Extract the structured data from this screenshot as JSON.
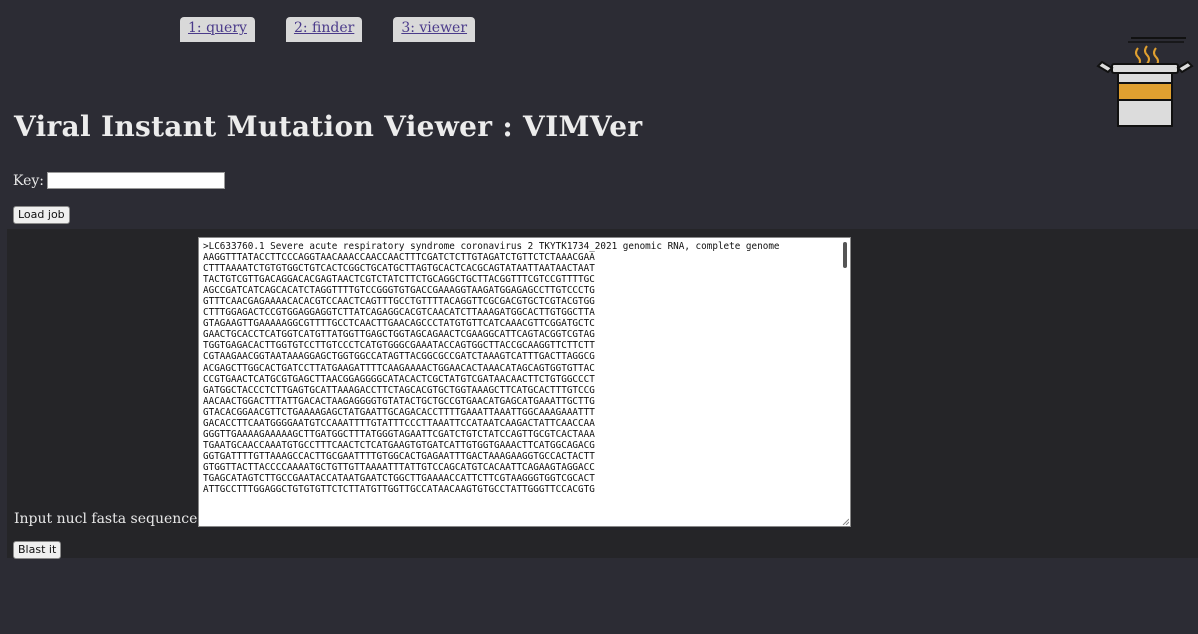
{
  "tabs": [
    {
      "label": "1: query"
    },
    {
      "label": "2: finder"
    },
    {
      "label": "3: viewer"
    }
  ],
  "title": "Viral Instant Mutation Viewer : VIMVer",
  "key": {
    "label": "Key:",
    "value": ""
  },
  "load_button": "Load job",
  "sequence": {
    "label": "Input nucl fasta sequence:",
    "text": ">LC633760.1 Severe acute respiratory syndrome coronavirus 2 TKYTK1734_2021 genomic RNA, complete genome\nAAGGTTTATACCTTCCCAGGTAACAAACCAACCAACTTTCGATCTCTTGTAGATCTGTTCTCTAAACGAA\nCTTTAAAATCTGTGTGGCTGTCACTCGGCTGCATGCTTAGTGCACTCACGCAGTATAATTAATAACTAAT\nTACTGTCGTTGACAGGACACGAGTAACTCGTCTATCTTCTGCAGGCTGCTTACGGTTTCGTCCGTTTTGC\nAGCCGATCATCAGCACATCTAGGTTTTGTCCGGGTGTGACCGAAAGGTAAGATGGAGAGCCTTGTCCCTG\nGTTTCAACGAGAAAACACACGTCCAACTCAGTTTGCCTGTTTTACAGGTTCGCGACGTGCTCGTACGTGG\nCTTTGGAGACTCCGTGGAGGAGGTCTTATCAGAGGCACGTCAACATCTTAAAGATGGCACTTGTGGCTTA\nGTAGAAGTTGAAAAAGGCGTTTTGCCTCAACTTGAACAGCCCTATGTGTTCATCAAACGTTCGGATGCTC\nGAACTGCACCTCATGGTCATGTTATGGTTGAGCTGGTAGCAGAACTCGAAGGCATTCAGTACGGTCGTAG\nTGGTGAGACACTTGGTGTCCTTGTCCCTCATGTGGGCGAAATACCAGTGGCTTACCGCAAGGTTCTTCTT\nCGTAAGAACGGTAATAAAGGAGCTGGTGGCCATAGTTACGGCGCCGATCTAAAGTCATTTGACTTAGGCG\nACGAGCTTGGCACTGATCCTTATGAAGATTTTCAAGAAAACTGGAACACTAAACATAGCAGTGGTGTTAC\nCCGTGAACTCATGCGTGAGCTTAACGGAGGGGCATACACTCGCTATGTCGATAACAACTTCTGTGGCCCT\nGATGGCTACCCTCTTGAGTGCATTAAAGACCTTCTAGCACGTGCTGGTAAAGCTTCATGCACTTTGTCCG\nAACAACTGGACTTTATTGACACTAAGAGGGGTGTATACTGCTGCCGTGAACATGAGCATGAAATTGCTTG\nGTACACGGAACGTTCTGAAAAGAGCTATGAATTGCAGACACCTTTTGAAATTAAATTGGCAAAGAAATTT\nGACACCTTCAATGGGGAATGTCCAAATTTTGTATTTCCCTTAAATTCCATAATCAAGACTATTCAACCAA\nGGGTTGAAAAGAAAAAGCTTGATGGCTTTATGGGTAGAATTCGATCTGTCTATCCAGTTGCGTCACTAAA\nTGAATGCAACCAAATGTGCCTTTCAACTCTCATGAAGTGTGATCATTGTGGTGAAACTTCATGGCAGACG\nGGTGATTTTGTTAAAGCCACTTGCGAATTTTGTGGCACTGAGAATTTGACTAAAGAAGGTGCCACTACTT\nGTGGTTACTTACCCCAAAATGCTGTTGTTAAAATTTATTGTCCAGCATGTCACAATTCAGAAGTAGGACC\nTGAGCATAGTCTTGCCGAATACCATAATGAATCTGGCTTGAAAACCATTCTTCGTAAGGGTGGTCGCACT\nATTGCCTTTGGAGGCTGTGTGTTCTCTTATGTTGGTTGCCATAACAAGTGTGCCTATTGGGTTCCACGTG"
  },
  "blast_button": "Blast it",
  "colors": {
    "background": "#2c2c34",
    "band": "#252528",
    "tab": "#d9d9d9",
    "logo_accent": "#e0a030"
  },
  "icons": [
    "pot-logo-icon"
  ]
}
